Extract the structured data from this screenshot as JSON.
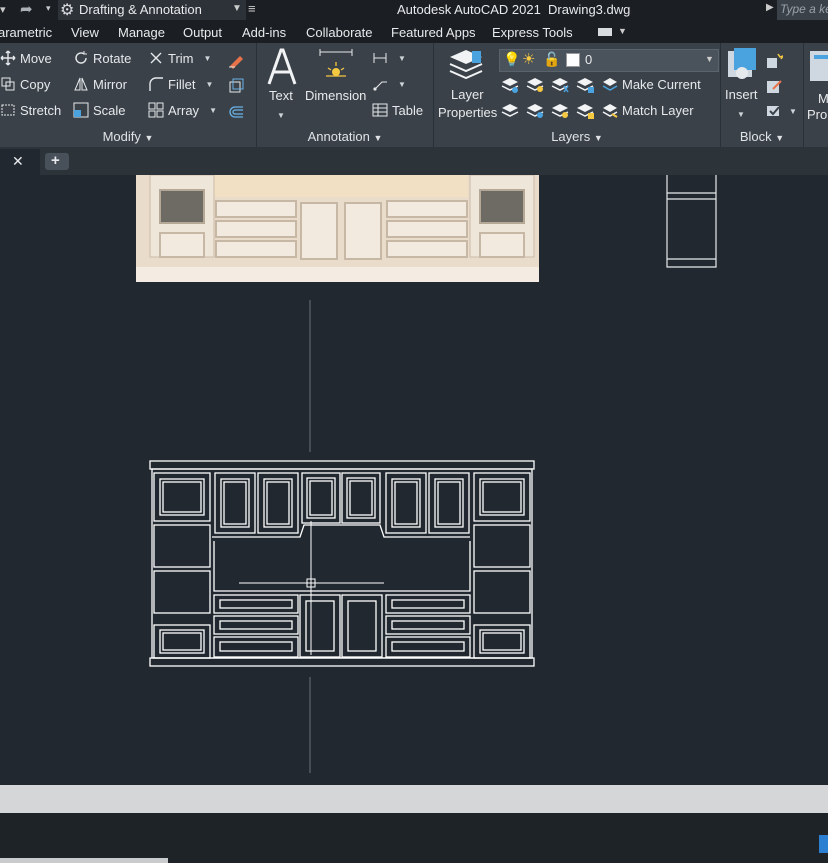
{
  "titlebar": {
    "workspace": "Drafting & Annotation",
    "app_title": "Autodesk AutoCAD 2021",
    "file_name": "Drawing3.dwg",
    "search_placeholder": "Type a ke"
  },
  "menu": {
    "items": [
      "arametric",
      "View",
      "Manage",
      "Output",
      "Add-ins",
      "Collaborate",
      "Featured Apps",
      "Express Tools"
    ]
  },
  "ribbon": {
    "modify": {
      "title": "Modify",
      "move": "Move",
      "copy": "Copy",
      "stretch": "Stretch",
      "rotate": "Rotate",
      "mirror": "Mirror",
      "scale": "Scale",
      "trim": "Trim",
      "fillet": "Fillet",
      "array": "Array"
    },
    "annotation": {
      "title": "Annotation",
      "text": "Text",
      "dimension": "Dimension",
      "table": "Table"
    },
    "layers": {
      "title": "Layers",
      "layer_properties_1": "Layer",
      "layer_properties_2": "Properties",
      "current_layer": "0",
      "make_current": "Make Current",
      "match_layer": "Match Layer"
    },
    "block": {
      "title": "Block",
      "insert": "Insert"
    },
    "properties_partial_1": "M",
    "properties_partial_2": "Prop"
  },
  "tabs": {
    "close_glyph": "✕",
    "add_glyph": "+"
  },
  "colors": {
    "canvas": "#212830",
    "ribbon": "#3a4149",
    "linework": "#ffffff"
  }
}
